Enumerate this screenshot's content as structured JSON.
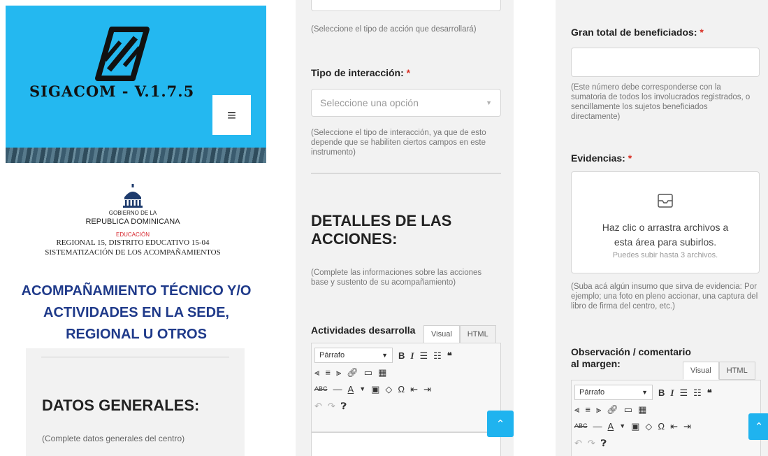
{
  "brand": {
    "title": "SIGACOM - V.1.7.5",
    "menu_icon": "hamburger-icon",
    "bg_color": "#24b8f0"
  },
  "gov_header": {
    "line1": "GOBIERNO DE LA",
    "line2": "REPUBLICA DOMINICANA",
    "line3": "EDUCACIÓN",
    "line4": "REGIONAL 15, DISTRITO EDUCATIVO 15-04",
    "line5": "SISTEMATIZACIÓN DE LOS ACOMPAÑAMIENTOS"
  },
  "headline": "ACOMPAÑAMIENTO TÉCNICO Y/O ACTIVIDADES EN LA SEDE, REGIONAL U OTROS",
  "datos_generales": {
    "title": "DATOS GENERALES:",
    "hint": "(Complete datos generales del centro)"
  },
  "form_middle": {
    "accion_hint": "(Seleccione el tipo de acción que desarrollará)",
    "interaccion_label": "Tipo de interacción:",
    "required_mark": "*",
    "interaccion_placeholder": "Seleccione una opción",
    "interaccion_hint": "(Seleccione el tipo de interacción, ya que de esto depende que se habiliten ciertos campos en este instrumento)",
    "detalles_title": "DETALLES DE LAS ACCIONES:",
    "detalles_hint": "(Complete las informaciones sobre las acciones base y sustento de su acompañamiento)",
    "actividades_label": "Actividades desarrolla"
  },
  "editor": {
    "tab_visual": "Visual",
    "tab_html": "HTML",
    "format_select": "Párrafo"
  },
  "form_right": {
    "beneficiados_label": "Gran total de beneficiados:",
    "required_mark": "*",
    "beneficiados_hint": "(Este número debe corresponderse con la sumatoria de todos los involucrados registrados, o sencillamente los sujetos beneficiados directamente)",
    "evidencias_label": "Evidencias:",
    "upload_main": "Haz clic o arrastra archivos a esta área para subirlos.",
    "upload_sub": "Puedes subir hasta 3 archivos.",
    "evidencias_hint": "(Suba acá algún insumo que sirva de evidencia: Por ejemplo; una foto en pleno accionar, una captura del libro de firma del centro, etc.)",
    "observacion_label": "Observación / comentario al margen:"
  },
  "colors": {
    "accent": "#1fb3ef",
    "headline": "#1f3a8a",
    "required": "#d93025",
    "panel_bg": "#f2f2f2"
  }
}
